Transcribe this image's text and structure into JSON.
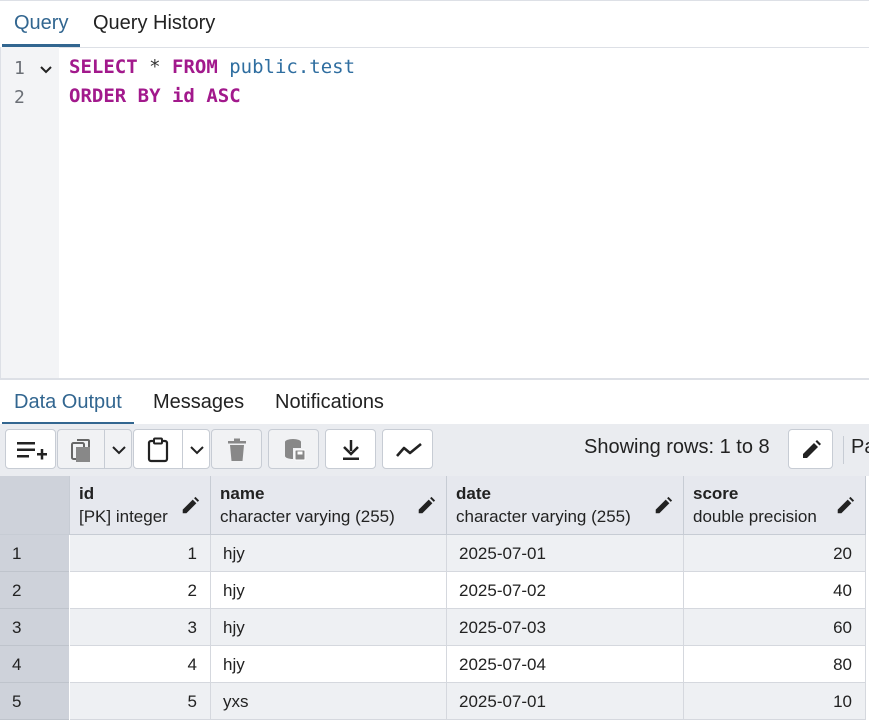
{
  "top_tabs": [
    {
      "label": "Query",
      "active": true
    },
    {
      "label": "Query History",
      "active": false
    }
  ],
  "editor": {
    "line_numbers": [
      "1",
      "2"
    ],
    "line1": {
      "kw1": "SELECT",
      "op": "*",
      "kw2": "FROM",
      "ident": "public.test"
    },
    "line2": {
      "kw1": "ORDER BY",
      "ident": "id",
      "kw2": "ASC"
    }
  },
  "bottom_tabs": [
    {
      "label": "Data Output",
      "active": true
    },
    {
      "label": "Messages",
      "active": false
    },
    {
      "label": "Notifications",
      "active": false
    }
  ],
  "toolbar": {
    "rows_label": "Showing rows: 1 to 8",
    "page_label_partial": "Pa"
  },
  "columns": [
    {
      "name": "id",
      "type": "[PK] integer"
    },
    {
      "name": "name",
      "type": "character varying (255)"
    },
    {
      "name": "date",
      "type": "character varying (255)"
    },
    {
      "name": "score",
      "type": "double precision"
    }
  ],
  "rows": [
    {
      "n": "1",
      "id": "1",
      "name": "hjy",
      "date": "2025-07-01",
      "score": "20"
    },
    {
      "n": "2",
      "id": "2",
      "name": "hjy",
      "date": "2025-07-02",
      "score": "40"
    },
    {
      "n": "3",
      "id": "3",
      "name": "hjy",
      "date": "2025-07-03",
      "score": "60"
    },
    {
      "n": "4",
      "id": "4",
      "name": "hjy",
      "date": "2025-07-04",
      "score": "80"
    },
    {
      "n": "5",
      "id": "5",
      "name": "yxs",
      "date": "2025-07-01",
      "score": "10"
    }
  ],
  "colors": {
    "accent": "#326690",
    "keyword": "#a2198c",
    "identifier": "#2f6ea0"
  }
}
